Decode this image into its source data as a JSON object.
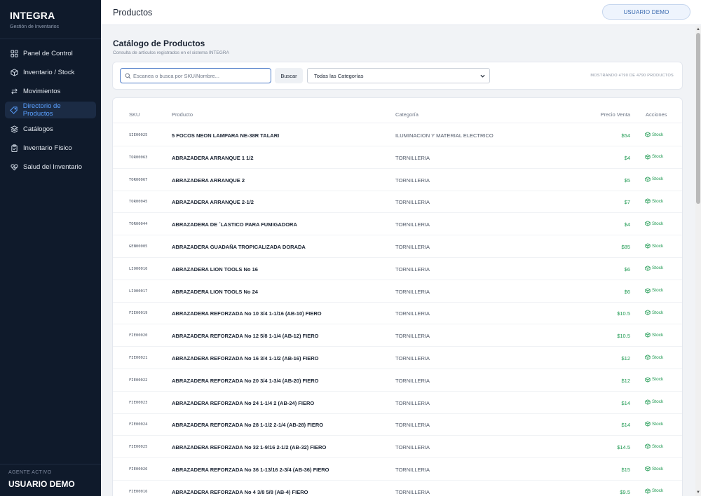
{
  "sidebar": {
    "brand_title": "INTEGRA",
    "brand_subtitle": "Gestión de Inventarios",
    "items": [
      {
        "label": "Panel de Control",
        "icon": "grid-icon",
        "active": false
      },
      {
        "label": "Inventario / Stock",
        "icon": "box-icon",
        "active": false
      },
      {
        "label": "Movimientos",
        "icon": "arrows-icon",
        "active": false
      },
      {
        "label": "Directorio de Productos",
        "icon": "tag-icon",
        "active": true
      },
      {
        "label": "Catálogos",
        "icon": "layers-icon",
        "active": false
      },
      {
        "label": "Inventario Físico",
        "icon": "clipboard-icon",
        "active": false
      },
      {
        "label": "Salud del Inventario",
        "icon": "heart-icon",
        "active": false
      }
    ],
    "agent_label": "AGENTE ACTIVO",
    "agent_name": "USUARIO DEMO"
  },
  "header": {
    "title": "Productos",
    "user_button": "USUARIO DEMO"
  },
  "page": {
    "title": "Catálogo de Productos",
    "subtitle": "Consulta de artículos registrados en el sistema INTEGRA"
  },
  "search": {
    "placeholder": "Escanea o busca por SKU/Nombre...",
    "value": "",
    "button_label": "Buscar",
    "category_selected": "Todas las Categorías",
    "count_text": "MOSTRANDO 4790 DE 4790 PRODUCTOS"
  },
  "table": {
    "headers": {
      "sku": "SKU",
      "product": "Producto",
      "category": "Categoría",
      "price": "Precio Venta",
      "actions": "Acciones"
    },
    "action_label": "Stock",
    "rows": [
      {
        "sku": "SIE00025",
        "product": "5 FOCOS NEON LAMPARA NE-38R TALARI",
        "category": "ILUMINACION Y MATERIAL ELECTRICO",
        "price": "$54"
      },
      {
        "sku": "TOR00063",
        "product": "ABRAZADERA ARRANQUE 1 1/2",
        "category": "TORNILLERIA",
        "price": "$4"
      },
      {
        "sku": "TOR00067",
        "product": "ABRAZADERA ARRANQUE 2",
        "category": "TORNILLERIA",
        "price": "$5"
      },
      {
        "sku": "TOR00045",
        "product": "ABRAZADERA ARRANQUE 2-1/2",
        "category": "TORNILLERIA",
        "price": "$7"
      },
      {
        "sku": "TOR00044",
        "product": "ABRAZADERA DE ´LASTICO PARA FUMIGADORA",
        "category": "TORNILLERIA",
        "price": "$4"
      },
      {
        "sku": "GEN00005",
        "product": "ABRAZADERA GUADAÑA TROPICALIZADA DORADA",
        "category": "TORNILLERIA",
        "price": "$85"
      },
      {
        "sku": "LIO00016",
        "product": "ABRAZADERA LION TOOLS No 16",
        "category": "TORNILLERIA",
        "price": "$6"
      },
      {
        "sku": "LIO00017",
        "product": "ABRAZADERA LION TOOLS No 24",
        "category": "TORNILLERIA",
        "price": "$6"
      },
      {
        "sku": "FIE00019",
        "product": "ABRAZADERA REFORZADA No 10 3/4 1-1/16 (AB-10) FIERO",
        "category": "TORNILLERIA",
        "price": "$10.5"
      },
      {
        "sku": "FIE00020",
        "product": "ABRAZADERA REFORZADA No 12 5/8 1-1/4 (AB-12) FIERO",
        "category": "TORNILLERIA",
        "price": "$10.5"
      },
      {
        "sku": "FIE00021",
        "product": "ABRAZADERA REFORZADA No 16 3/4 1-1/2 (AB-16) FIERO",
        "category": "TORNILLERIA",
        "price": "$12"
      },
      {
        "sku": "FIE00022",
        "product": "ABRAZADERA REFORZADA No 20 3/4 1-3/4 (AB-20) FIERO",
        "category": "TORNILLERIA",
        "price": "$12"
      },
      {
        "sku": "FIE00023",
        "product": "ABRAZADERA REFORZADA No 24 1-1/4 2 (AB-24) FIERO",
        "category": "TORNILLERIA",
        "price": "$14"
      },
      {
        "sku": "FIE00024",
        "product": "ABRAZADERA REFORZADA No 28 1-1/2 2-1/4 (AB-28) FIERO",
        "category": "TORNILLERIA",
        "price": "$14"
      },
      {
        "sku": "FIE00025",
        "product": "ABRAZADERA REFORZADA No 32 1-9/16 2-1/2 (AB-32) FIERO",
        "category": "TORNILLERIA",
        "price": "$14.5"
      },
      {
        "sku": "FIE00026",
        "product": "ABRAZADERA REFORZADA No 36 1-13/16 2-3/4 (AB-36) FIERO",
        "category": "TORNILLERIA",
        "price": "$15"
      },
      {
        "sku": "FIE00016",
        "product": "ABRAZADERA REFORZADA No 4 3/8 5/8 (AB-4) FIERO",
        "category": "TORNILLERIA",
        "price": "$9.5"
      }
    ]
  },
  "colors": {
    "sidebar_bg": "#0f1a2b",
    "active_nav": "#5aa0ff",
    "price_green": "#1f9a52"
  }
}
